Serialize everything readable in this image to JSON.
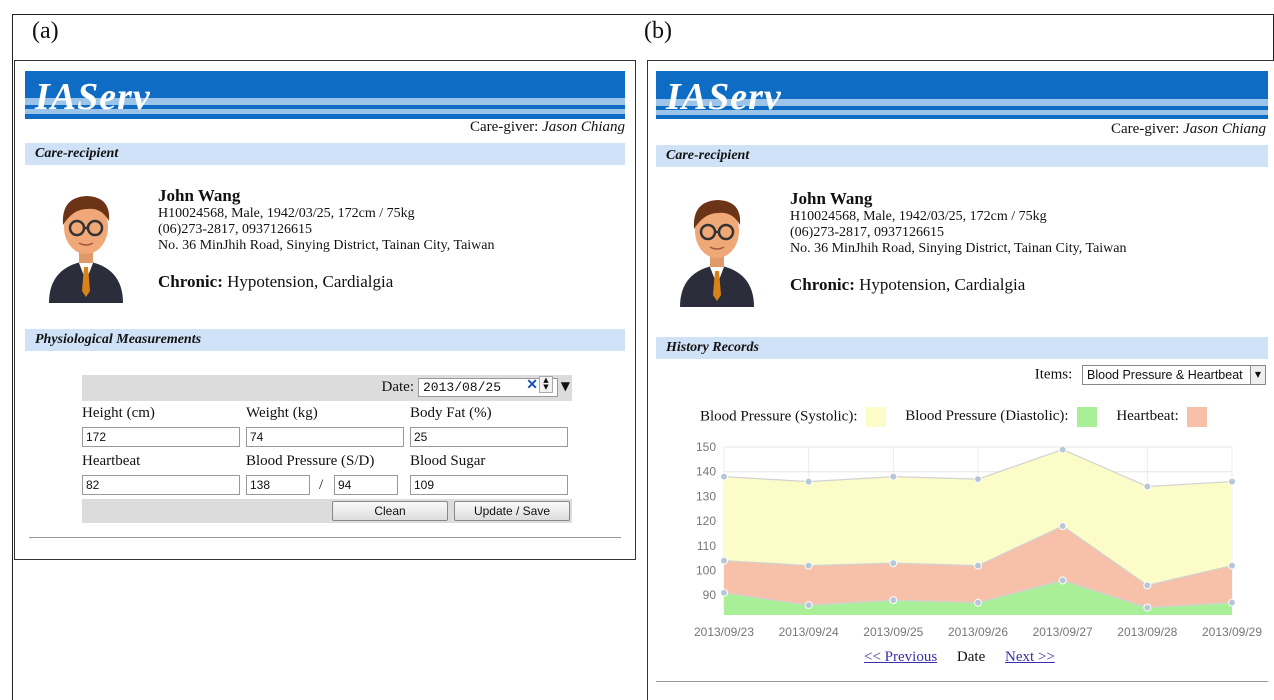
{
  "labels": {
    "a": "(a)",
    "b": "(b)"
  },
  "app": {
    "logo": "IAServ"
  },
  "caregiver": {
    "label": "Care-giver:",
    "name": "Jason Chiang"
  },
  "recipient": {
    "section_title": "Care-recipient",
    "name": "John Wang",
    "line1": "H10024568, Male, 1942/03/25, 172cm / 75kg",
    "line2": "(06)273-2817, 0937126615",
    "line3": "No. 36 MinJhih Road, Sinying District, Tainan City, Taiwan",
    "chronic_label": "Chronic:",
    "chronic_value": "Hypotension, Cardialgia"
  },
  "measurements": {
    "section_title": "Physiological Measurements",
    "date_label": "Date:",
    "date_value": "2013/08/25",
    "fields": {
      "height": {
        "label": "Height (cm)",
        "value": "172"
      },
      "weight": {
        "label": "Weight (kg)",
        "value": "74"
      },
      "bodyfat": {
        "label": "Body Fat (%)",
        "value": "25"
      },
      "heartbeat": {
        "label": "Heartbeat",
        "value": "82"
      },
      "bp": {
        "label": "Blood Pressure (S/D)",
        "systolic": "138",
        "diastolic": "94",
        "sep": "/"
      },
      "sugar": {
        "label": "Blood Sugar",
        "value": "109"
      }
    },
    "clean_label": "Clean",
    "save_label": "Update / Save"
  },
  "history": {
    "section_title": "History Records",
    "items_label": "Items:",
    "items_value": "Blood Pressure & Heartbeat",
    "prev_label": "<< Previous",
    "date_label": "Date",
    "next_label": "Next >>"
  },
  "colors": {
    "banner": "#0e6cc4",
    "section_bar": "#cfe2f7",
    "systolic": "#fcfcc8",
    "heartbeat": "#f7c0a9",
    "diastolic": "#a8ef98"
  },
  "chart_data": {
    "type": "area",
    "x": [
      "2013/09/23",
      "2013/09/24",
      "2013/09/25",
      "2013/09/26",
      "2013/09/27",
      "2013/09/28",
      "2013/09/29"
    ],
    "ylim": [
      82,
      150
    ],
    "yticks": [
      90,
      100,
      110,
      120,
      130,
      140,
      150
    ],
    "grid": true,
    "legend_position": "top",
    "series": [
      {
        "name": "Blood Pressure (Systolic):",
        "values": [
          138,
          136,
          138,
          137,
          149,
          134,
          136
        ],
        "color": "#fcfcc8"
      },
      {
        "name": "Blood Pressure (Diastolic):",
        "values": [
          91,
          86,
          88,
          87,
          96,
          85,
          87
        ],
        "color": "#a8ef98"
      },
      {
        "name": "Heartbeat:",
        "values": [
          104,
          102,
          103,
          102,
          118,
          94,
          102
        ],
        "color": "#f7c0a9"
      }
    ]
  }
}
